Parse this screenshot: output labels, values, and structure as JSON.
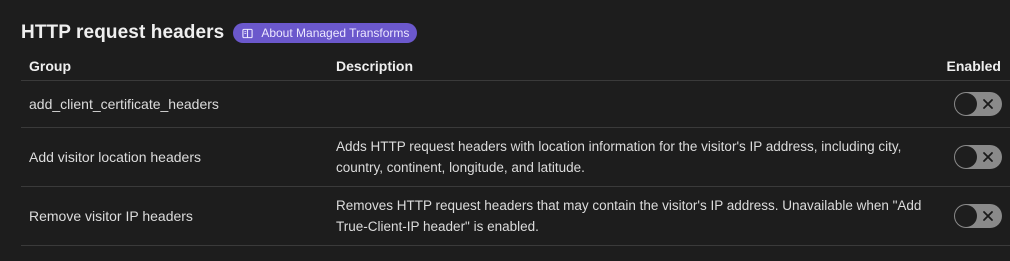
{
  "header": {
    "title": "HTTP request headers",
    "about_badge": {
      "label": "About Managed Transforms",
      "icon": "book-icon"
    }
  },
  "table": {
    "columns": {
      "group": "Group",
      "description": "Description",
      "enabled": "Enabled"
    },
    "rows": [
      {
        "group": "add_client_certificate_headers",
        "description": "",
        "enabled": false
      },
      {
        "group": "Add visitor location headers",
        "description_lines": [
          "Adds HTTP request headers with location information for the visitor's IP address, including city,",
          "country, continent, longitude, and latitude."
        ],
        "enabled": false
      },
      {
        "group": "Remove visitor IP headers",
        "description_lines": [
          "Removes HTTP request headers that may contain the visitor's IP address. Unavailable when \"Add",
          "True-Client-IP header\" is enabled."
        ],
        "enabled": false
      }
    ]
  },
  "colors": {
    "background": "#1d1d1d",
    "badge": "#6b58cc",
    "toggle_off": "#8a8a8a",
    "divider": "#3a3a3a"
  }
}
